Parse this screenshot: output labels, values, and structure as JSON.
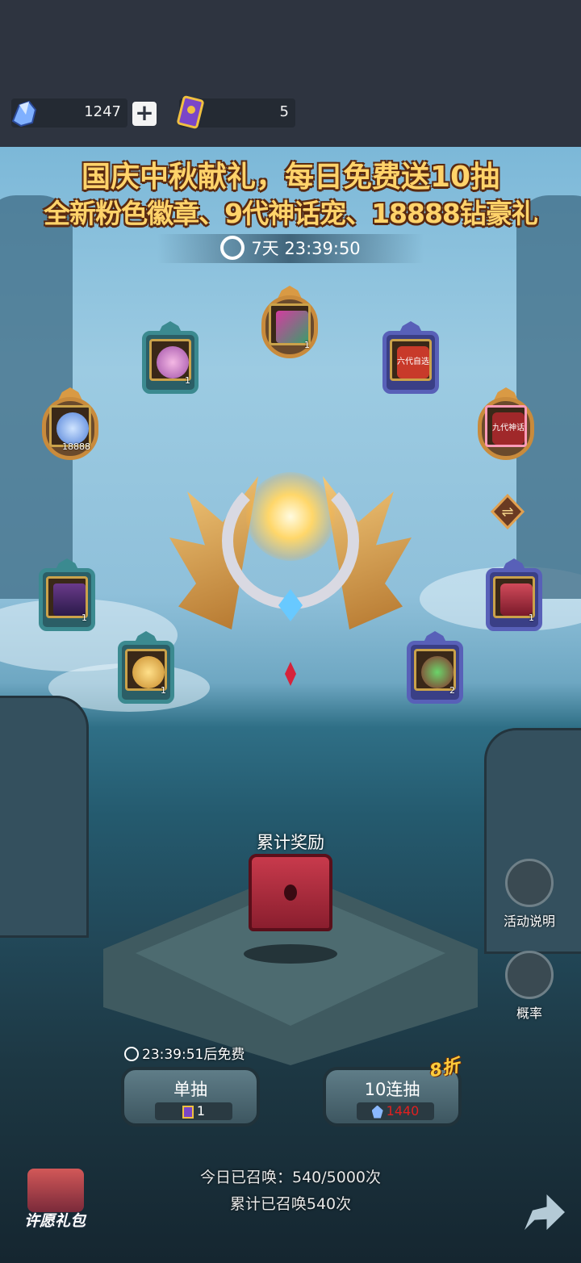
{
  "currency": {
    "gems": "1247",
    "tickets": "5",
    "add_label": "+"
  },
  "banner": {
    "line1": "国庆中秋献礼，每日免费送10抽",
    "line2": "全新粉色徽章、9代神话宠、18888钻豪礼",
    "countdown": "7天 23:39:50"
  },
  "rewards": [
    {
      "name": "gem-bundle",
      "count": "18888",
      "style": "gold"
    },
    {
      "name": "pink-badge",
      "count": "1",
      "style": "teal"
    },
    {
      "name": "scroll",
      "count": "1",
      "style": "gold"
    },
    {
      "name": "gen6-select",
      "count": "",
      "style": "purple",
      "label": "六代自选"
    },
    {
      "name": "gen9-myth",
      "count": "",
      "style": "gold",
      "label": "九代神话"
    },
    {
      "name": "pet-card",
      "count": "1",
      "style": "teal"
    },
    {
      "name": "treasure-chest",
      "count": "1",
      "style": "purple"
    },
    {
      "name": "coin-bag",
      "count": "1",
      "style": "teal"
    },
    {
      "name": "fruit",
      "count": "2",
      "style": "purple"
    }
  ],
  "cumulative": {
    "label": "累计奖励"
  },
  "side": {
    "rules_label": "活动说明",
    "odds_label": "概率"
  },
  "draw": {
    "free_timer": "23:39:51后免费",
    "single_label": "单抽",
    "single_cost": "1",
    "multi_label": "10连抽",
    "multi_cost": "1440",
    "discount": "8折"
  },
  "stats": {
    "today": "今日已召唤：540/5000次",
    "total": "累计已召唤540次"
  },
  "gift": {
    "label": "许愿礼包"
  },
  "colors": {
    "title_gold": "#ffd36a",
    "cost_red": "#e02020",
    "discount": "#ffcc3c"
  }
}
